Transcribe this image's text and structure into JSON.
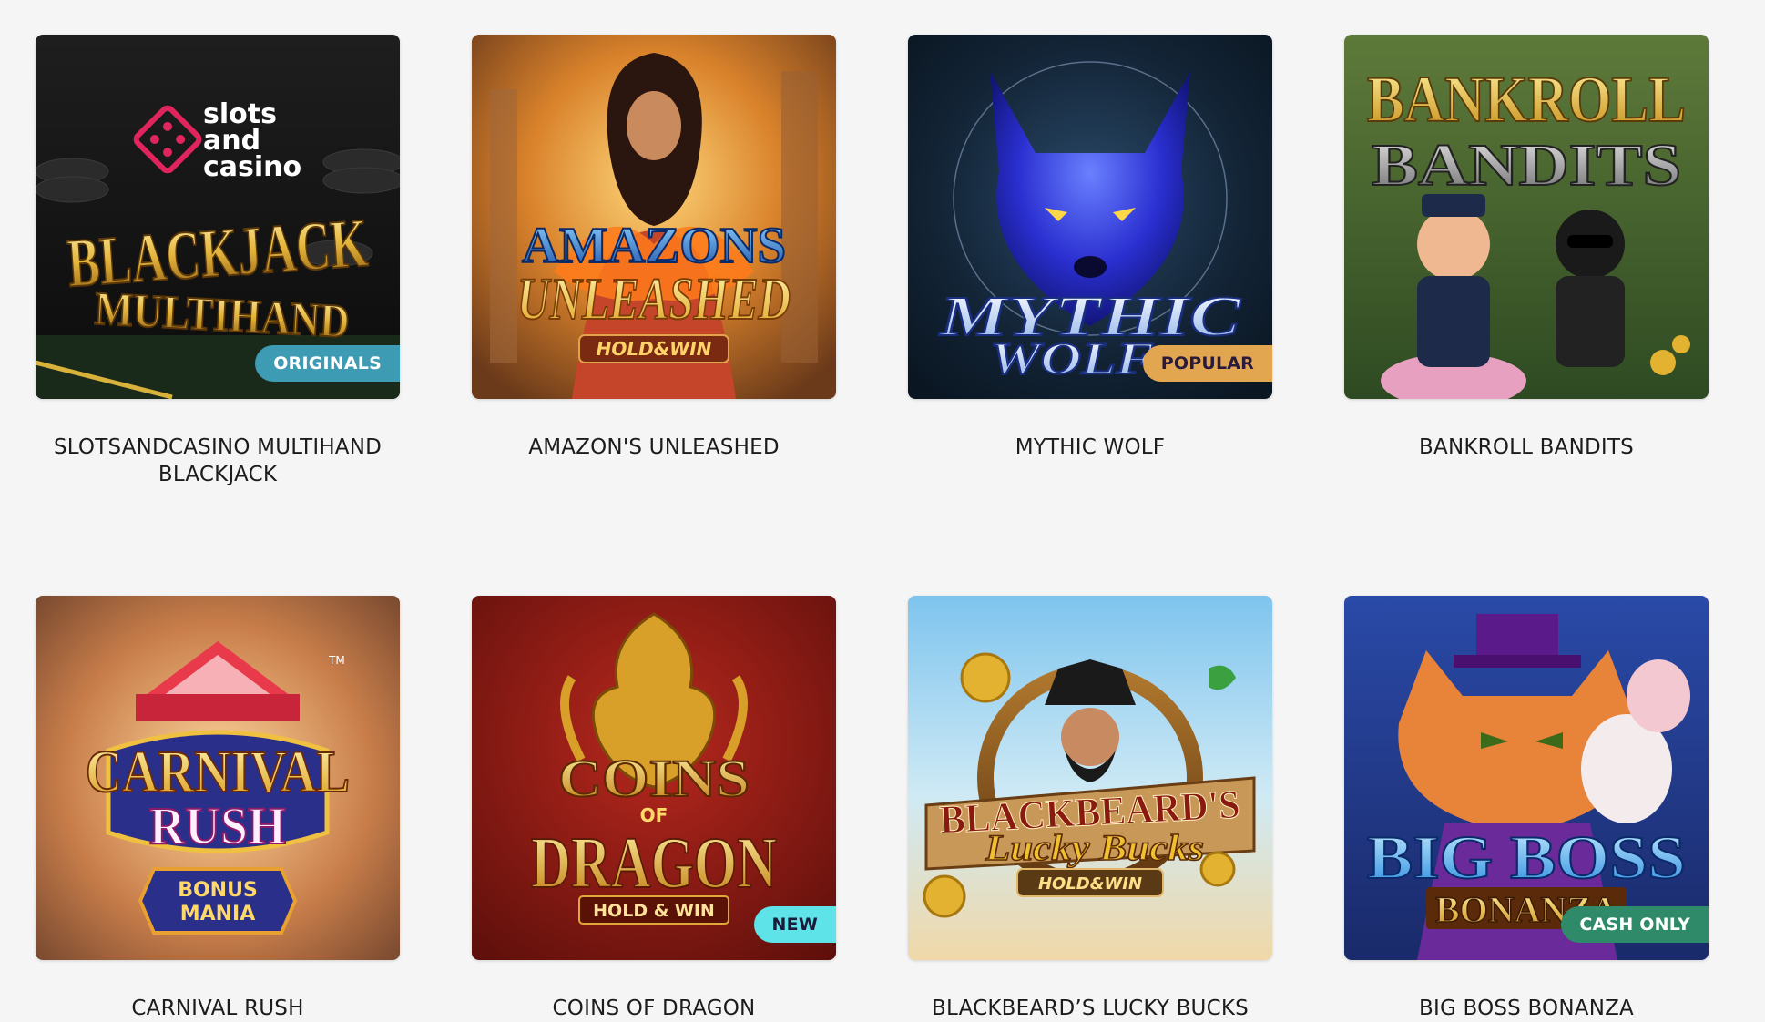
{
  "games": [
    {
      "title": "SLOTSANDCASINO MULTIHAND BLACKJACK",
      "badge": "ORIGINALS",
      "badge_color": "#3d9bb3",
      "badge_text_color": "#ffffff",
      "art_words": [
        "slots",
        "and",
        "casino",
        "BLACKJACK",
        "MULTIHAND"
      ]
    },
    {
      "title": "AMAZON'S UNLEASHED",
      "badge": "",
      "art_words": [
        "AMAZONS",
        "UNLEASHED",
        "HOLD&WIN"
      ]
    },
    {
      "title": "MYTHIC WOLF",
      "badge": "POPULAR",
      "badge_color": "#e2a651",
      "badge_text_color": "#2a1b3d",
      "art_words": [
        "MYTHIC",
        "WOLF"
      ]
    },
    {
      "title": "BANKROLL BANDITS",
      "badge": "",
      "art_words": [
        "BANKROLL",
        "BANDITS"
      ]
    },
    {
      "title": "CARNIVAL RUSH",
      "badge": "",
      "art_words": [
        "CARNIVAL",
        "RUSH",
        "BONUS",
        "MANIA",
        "TM"
      ]
    },
    {
      "title": "COINS OF DRAGON",
      "badge": "NEW",
      "badge_color": "#5ee3e8",
      "badge_text_color": "#1b1b3a",
      "art_words": [
        "COINS",
        "OF",
        "DRAGON",
        "HOLD & WIN"
      ]
    },
    {
      "title": "BLACKBEARD’S LUCKY BUCKS",
      "badge": "",
      "art_words": [
        "BLACKBEARD'S",
        "Lucky Bucks",
        "HOLD&WIN"
      ]
    },
    {
      "title": "BIG BOSS BONANZA",
      "badge": "CASH ONLY",
      "badge_color": "#2f8a6a",
      "badge_text_color": "#ffffff",
      "art_words": [
        "BIG BOSS",
        "BONANZA"
      ]
    }
  ]
}
